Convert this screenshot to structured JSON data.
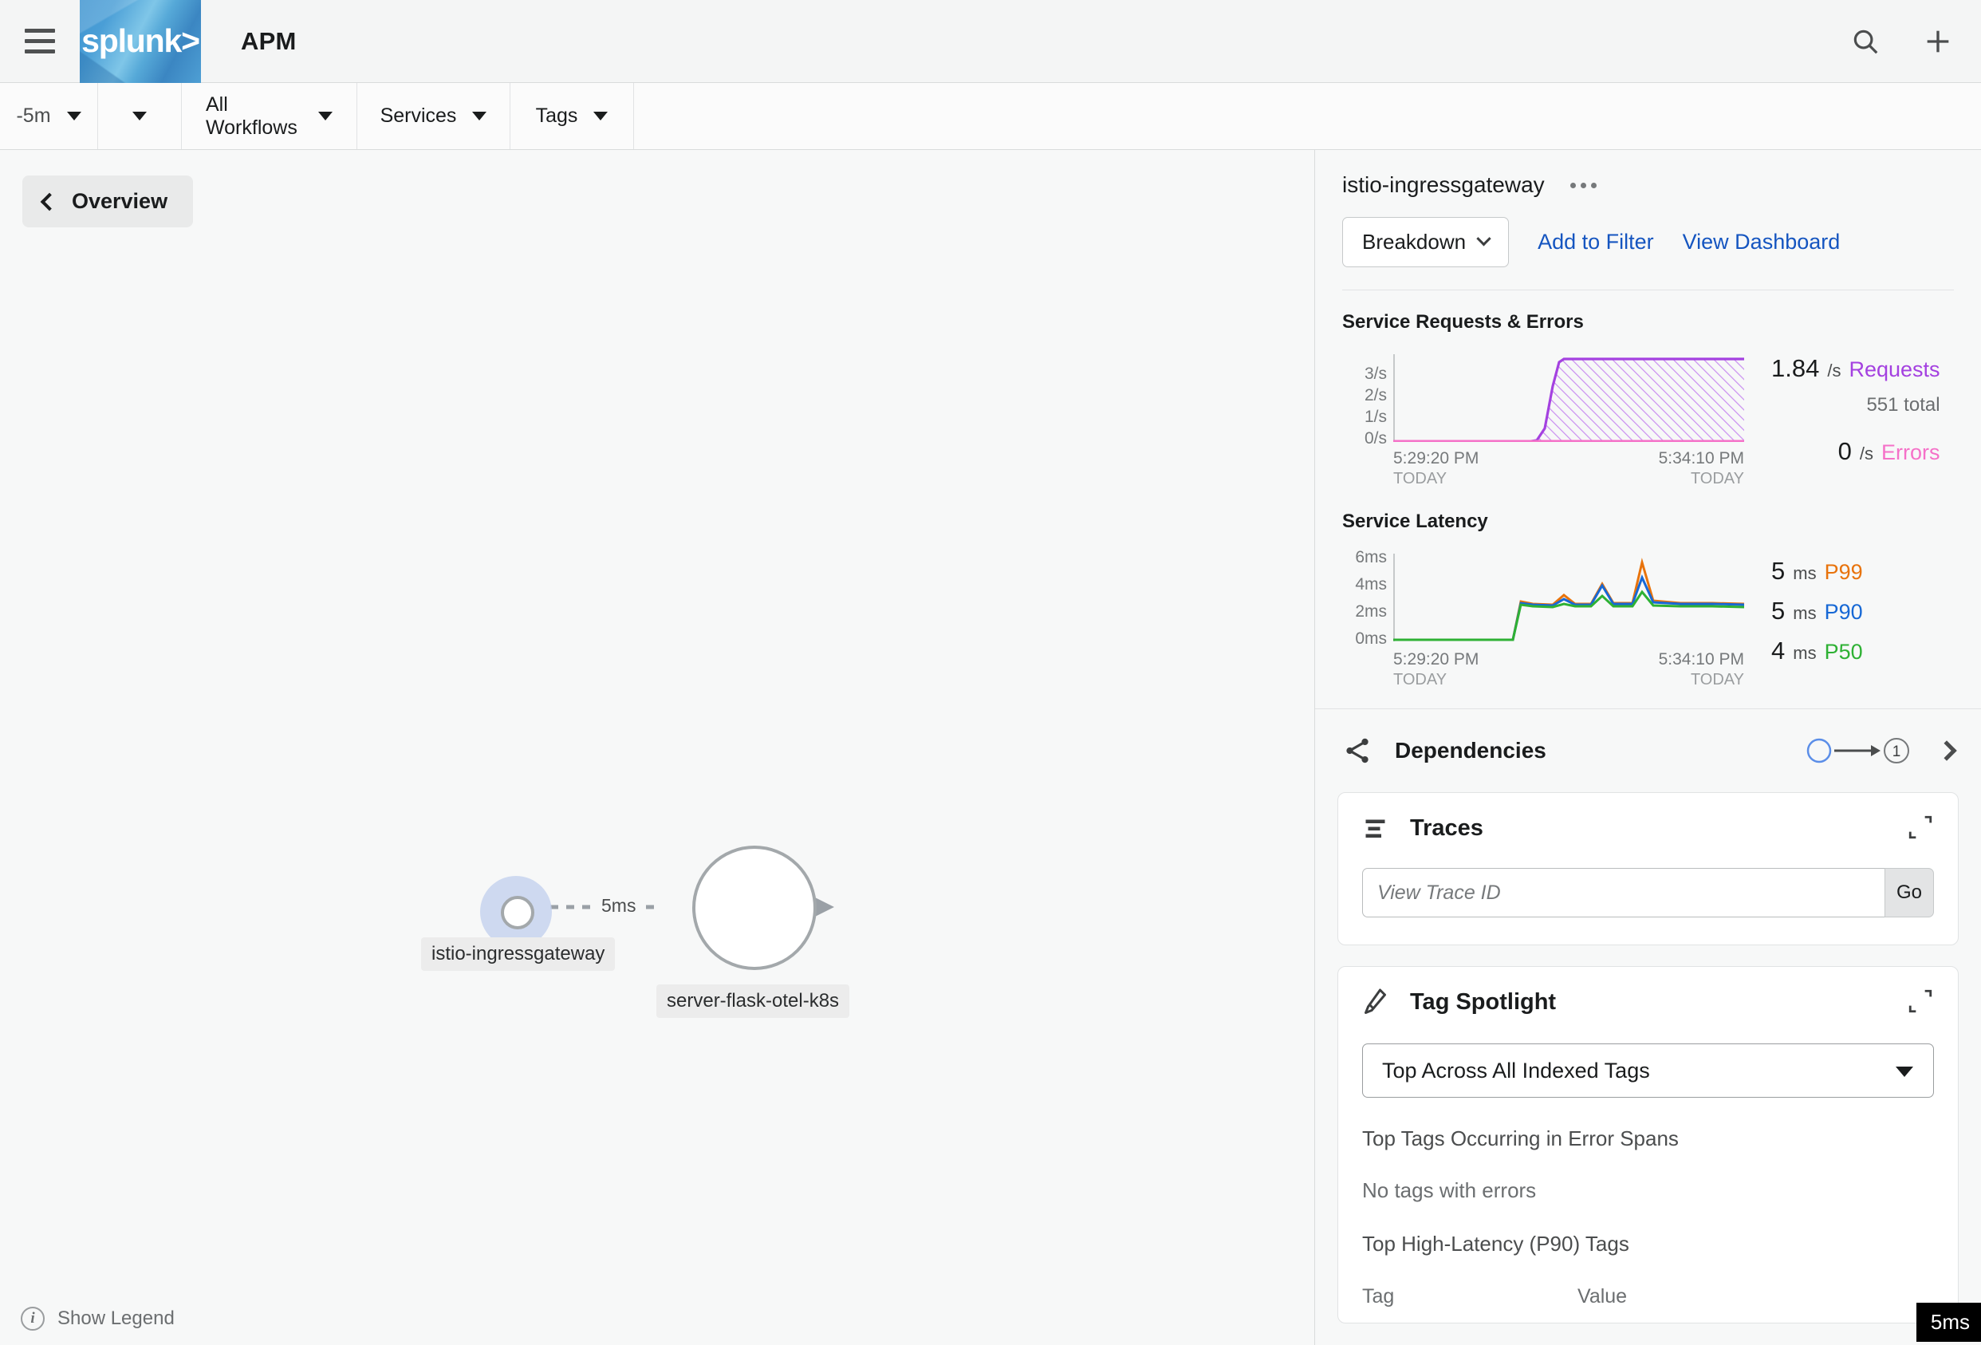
{
  "topbar": {
    "menu_icon": "hamburger-icon",
    "logo_text": "splunk>",
    "app_title": "APM",
    "search_icon": "search-icon",
    "add_icon": "plus-icon"
  },
  "filterbar": {
    "time_range": "-5m",
    "workflows": "All Workflows",
    "services": "Services",
    "tags": "Tags"
  },
  "map": {
    "overview_label": "Overview",
    "show_legend_label": "Show Legend",
    "info_glyph": "i",
    "edge_latency": "5ms",
    "nodes": [
      {
        "name": "istio-ingressgateway",
        "selected": true
      },
      {
        "name": "server-flask-otel-k8s",
        "selected": false
      }
    ]
  },
  "panel": {
    "service_name": "istio-ingressgateway",
    "more_icon": "more-options-icon",
    "breakdown_label": "Breakdown",
    "add_to_filter_label": "Add to Filter",
    "view_dashboard_label": "View Dashboard",
    "requests": {
      "title": "Service Requests & Errors",
      "requests_value": "1.84",
      "requests_unit": "/s",
      "requests_label": "Requests",
      "total_value": "551",
      "total_label": "total",
      "errors_value": "0",
      "errors_unit": "/s",
      "errors_label": "Errors",
      "requests_color": "#a441e0",
      "errors_color": "#f571c8"
    },
    "latency": {
      "title": "Service Latency",
      "rows": [
        {
          "value": "5",
          "unit": "ms",
          "label": "P99",
          "color": "#e8730c"
        },
        {
          "value": "5",
          "unit": "ms",
          "label": "P90",
          "color": "#1768d5"
        },
        {
          "value": "4",
          "unit": "ms",
          "label": "P50",
          "color": "#2eb134"
        }
      ]
    },
    "dependencies": {
      "title": "Dependencies",
      "share_icon": "share-icon",
      "count": "1",
      "chevron_icon": "chevron-right-icon"
    },
    "traces": {
      "title": "Traces",
      "list_icon": "trace-list-icon",
      "expand_icon": "expand-icon",
      "input_placeholder": "View Trace ID",
      "input_value": "",
      "go_label": "Go"
    },
    "tag_spotlight": {
      "title": "Tag Spotlight",
      "flask_icon": "tag-spotlight-icon",
      "expand_icon": "expand-icon",
      "selected_option": "Top Across All Indexed Tags",
      "error_section_label": "Top Tags Occurring in Error Spans",
      "no_errors_text": "No tags with errors",
      "latency_section_label": "Top High-Latency (P90) Tags",
      "col_tag": "Tag",
      "col_value": "Value",
      "tooltip_badge": "5ms"
    }
  },
  "chart_data": [
    {
      "type": "area",
      "title": "Service Requests & Errors",
      "xlabel": "",
      "ylabel": "",
      "ylim": [
        0,
        4
      ],
      "yticks": [
        "0/s",
        "1/s",
        "2/s",
        "3/s"
      ],
      "x_start": "5:29:20 PM",
      "x_start_day": "TODAY",
      "x_end": "5:34:10 PM",
      "x_end_day": "TODAY",
      "grid": false,
      "legend": "right",
      "series": [
        {
          "name": "Requests",
          "color": "#a441e0",
          "fill": "hatched",
          "x": [
            0,
            38,
            44,
            47,
            50,
            54,
            100
          ],
          "values": [
            0,
            0,
            0.25,
            2.2,
            3.55,
            3.6,
            3.6
          ]
        },
        {
          "name": "Errors",
          "color": "#f571c8",
          "x": [
            0,
            100
          ],
          "values": [
            0,
            0
          ]
        }
      ]
    },
    {
      "type": "line",
      "title": "Service Latency",
      "xlabel": "",
      "ylabel": "",
      "ylim": [
        0,
        7
      ],
      "yticks": [
        "0ms",
        "2ms",
        "4ms",
        "6ms"
      ],
      "x_start": "5:29:20 PM",
      "x_start_day": "TODAY",
      "x_end": "5:34:10 PM",
      "x_end_day": "TODAY",
      "grid": false,
      "legend": "right",
      "series": [
        {
          "name": "P99",
          "color": "#e8730c",
          "x": [
            0,
            40,
            44,
            48,
            55,
            58,
            62,
            68,
            72,
            76,
            80,
            84,
            88,
            92,
            96,
            100
          ],
          "values": [
            0,
            0,
            2.7,
            2.75,
            2.8,
            3.5,
            2.85,
            2.85,
            4.3,
            2.9,
            2.9,
            6.1,
            3.0,
            2.9,
            2.9,
            2.9
          ]
        },
        {
          "name": "P90",
          "color": "#1768d5",
          "x": [
            0,
            40,
            44,
            48,
            55,
            58,
            62,
            68,
            72,
            76,
            80,
            84,
            88,
            92,
            96,
            100
          ],
          "values": [
            0,
            0,
            2.65,
            2.7,
            2.72,
            3.2,
            2.75,
            2.78,
            4.2,
            2.8,
            2.8,
            4.8,
            2.85,
            2.8,
            2.8,
            2.82
          ]
        },
        {
          "name": "P50",
          "color": "#2eb134",
          "x": [
            0,
            40,
            44,
            48,
            55,
            58,
            62,
            68,
            72,
            76,
            80,
            84,
            88,
            92,
            96,
            100
          ],
          "values": [
            0,
            0,
            2.6,
            2.6,
            2.55,
            2.75,
            2.6,
            2.6,
            3.35,
            2.6,
            2.6,
            3.65,
            2.65,
            2.6,
            2.6,
            2.62
          ]
        }
      ]
    }
  ]
}
